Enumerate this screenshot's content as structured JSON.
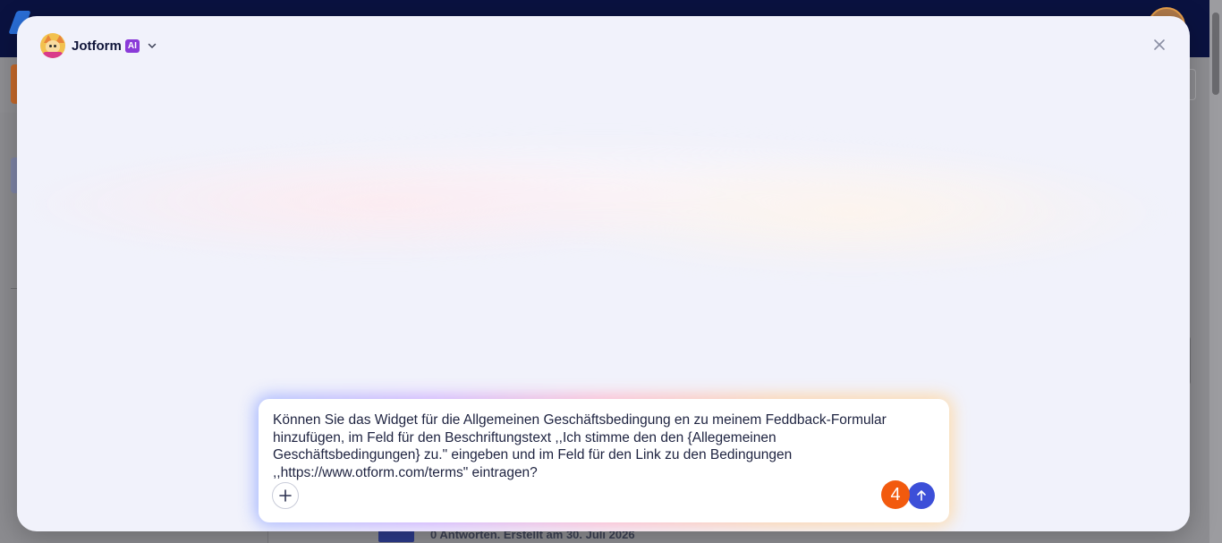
{
  "background": {
    "row_meta": "0 Antworten. Erstellt am 30. Juli 2026"
  },
  "modal": {
    "brand_name": "Jotform",
    "ai_badge": "AI"
  },
  "chat": {
    "message": "Können Sie das Widget für die Allgemeinen Geschäftsbedingung en zu meinem Feddback-Formular hinzufügen, im Feld für den Beschriftungstext ,,Ich stimme den den {Allegemeinen Geschäftsbedingungen} zu.\" eingeben und im Feld für den Link zu den Bedingungen ,,https://www.otform.com/terms\" eintragen?",
    "step_badge": "4"
  },
  "icons": {
    "brand": "jotform-ai-avatar-icon",
    "dropdown": "chevron-down-icon",
    "close": "close-icon",
    "attach": "plus-icon",
    "send": "arrow-up-icon"
  },
  "colors": {
    "topbar": "#0a1240",
    "ai_badge": "#8a3bd8",
    "send_button": "#3c4fd8",
    "step_badge": "#f25a0e"
  }
}
